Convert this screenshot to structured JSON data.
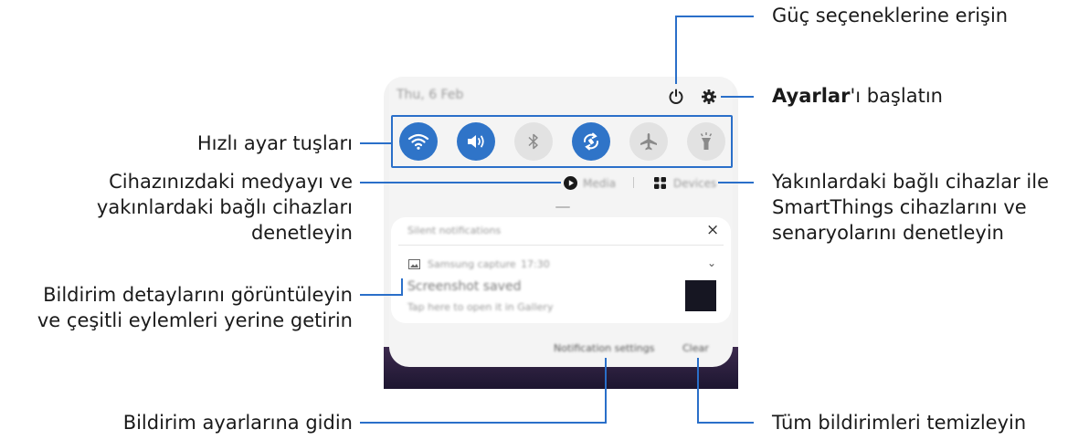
{
  "colors": {
    "accent": "#2a6fc9",
    "tile_on": "#2f74c8",
    "tile_off": "#e2e2e2"
  },
  "panel": {
    "date": "Thu, 6 Feb",
    "media_label": "Media",
    "devices_label": "Devices",
    "notification_section_title": "Silent notifications",
    "notification": {
      "app": "Samsung capture",
      "time": "17:30",
      "title": "Screenshot saved",
      "body": "Tap here to open it in Gallery"
    },
    "notification_settings_label": "Notification settings",
    "clear_label": "Clear"
  },
  "quick_tiles": [
    {
      "icon": "wifi-icon",
      "state": "on"
    },
    {
      "icon": "sound-icon",
      "state": "on"
    },
    {
      "icon": "bluetooth-icon",
      "state": "off"
    },
    {
      "icon": "auto-rotate-icon",
      "state": "on"
    },
    {
      "icon": "airplane-icon",
      "state": "off"
    },
    {
      "icon": "flashlight-icon",
      "state": "off"
    }
  ],
  "callouts": {
    "power": "Güç seçeneklerine erişin",
    "settings_bold": "Ayarlar",
    "settings_rest": "'ı başlatın",
    "quick_settings": "Hızlı ayar tuşları",
    "media_1": "Cihazınızdaki medyayı ve",
    "media_2": "yakınlardaki bağlı cihazları",
    "media_3": "denetleyin",
    "devices_1": "Yakınlardaki bağlı cihazlar ile",
    "devices_2": "SmartThings cihazlarını ve",
    "devices_3": "senaryolarını denetleyin",
    "details_1": "Bildirim detaylarını görüntüleyin",
    "details_2": "ve çeşitli eylemleri yerine getirin",
    "notif_settings": "Bildirim ayarlarına gidin",
    "clear_all": "Tüm bildirimleri temizleyin"
  }
}
